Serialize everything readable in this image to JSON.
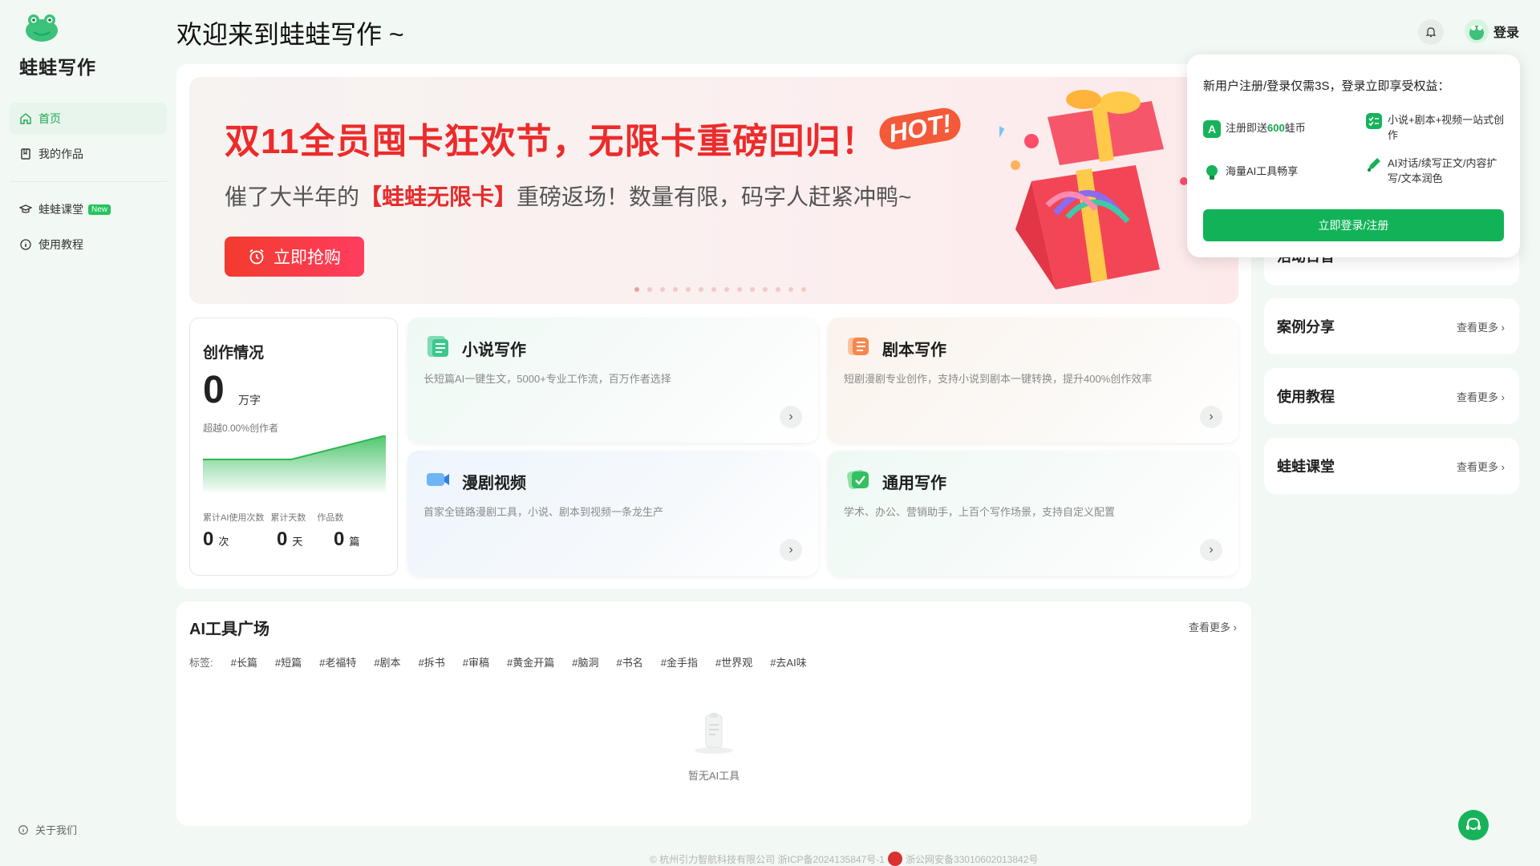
{
  "app": {
    "name": "蛙蛙写作"
  },
  "sidebar": {
    "items": [
      {
        "label": "首页",
        "icon": "home-icon"
      },
      {
        "label": "我的作品",
        "icon": "book-icon"
      },
      {
        "label": "蛙蛙课堂",
        "icon": "graduation-cap-icon",
        "badge": "New"
      },
      {
        "label": "使用教程",
        "icon": "info-icon"
      }
    ],
    "about": "关于我们"
  },
  "header": {
    "welcome": "欢迎来到蛙蛙写作 ~",
    "login": "登录"
  },
  "banner": {
    "title": "双11全员囤卡狂欢节，无限卡重磅回归！",
    "hot": "HOT!",
    "subtitle_pre": "催了大半年的",
    "subtitle_hl": "【蛙蛙无限卡】",
    "subtitle_post": "重磅返场！数量有限，码字人赶紧冲鸭~",
    "button": "立即抢购"
  },
  "stats": {
    "title": "创作情况",
    "words": "0",
    "words_unit": "万字",
    "exceed": "超越0.00%创作者",
    "labels": [
      "累计AI使用次数",
      "累计天数",
      "作品数"
    ],
    "values": [
      {
        "value": "0",
        "unit": "次"
      },
      {
        "value": "0",
        "unit": "天"
      },
      {
        "value": "0",
        "unit": "篇"
      }
    ]
  },
  "cards": [
    {
      "title": "小说写作",
      "desc": "长短篇AI一键生文，5000+专业工作流，百万作者选择",
      "icon": "novel-icon"
    },
    {
      "title": "剧本写作",
      "desc": "短剧漫剧专业创作，支持小说到剧本一键转换，提升400%创作效率",
      "icon": "script-icon"
    },
    {
      "title": "漫剧视频",
      "desc": "首家全链路漫剧工具，小说、剧本到视频一条龙生产",
      "icon": "video-icon"
    },
    {
      "title": "通用写作",
      "desc": "学术、办公、营销助手，上百个写作场景，支持自定义配置",
      "icon": "general-icon"
    }
  ],
  "tools": {
    "title": "AI工具广场",
    "more": "查看更多 ›",
    "tag_label": "标签:",
    "tags": [
      "#长篇",
      "#短篇",
      "#老福特",
      "#剧本",
      "#拆书",
      "#审稿",
      "#黄金开篇",
      "#脑洞",
      "#书名",
      "#金手指",
      "#世界观",
      "#去AI味"
    ],
    "empty": "暂无AI工具"
  },
  "right": {
    "items": [
      {
        "title": "活动日音",
        "more": ""
      },
      {
        "title": "案例分享",
        "more": "查看更多 ›"
      },
      {
        "title": "使用教程",
        "more": "查看更多 ›"
      },
      {
        "title": "蛙蛙课堂",
        "more": "查看更多 ›"
      }
    ]
  },
  "popup": {
    "head": "新用户注册/登录仅需3S，登录立即享受权益：",
    "b1_pre": "注册即送",
    "b1_hl": "600",
    "b1_post": "蛙币",
    "b2": "小说+剧本+视频一站式创作",
    "b3": "海量AI工具畅享",
    "b4": "AI对话/续写正文/内容扩写/文本润色",
    "button": "立即登录/注册"
  },
  "footer": {
    "left": "© 杭州引力智航科技有限公司 浙ICP备2024135847号-1",
    "right": "浙公网安备33010602013842号"
  },
  "colors": {
    "brand": "#12b358",
    "banner_red": "#ec2b2b"
  }
}
